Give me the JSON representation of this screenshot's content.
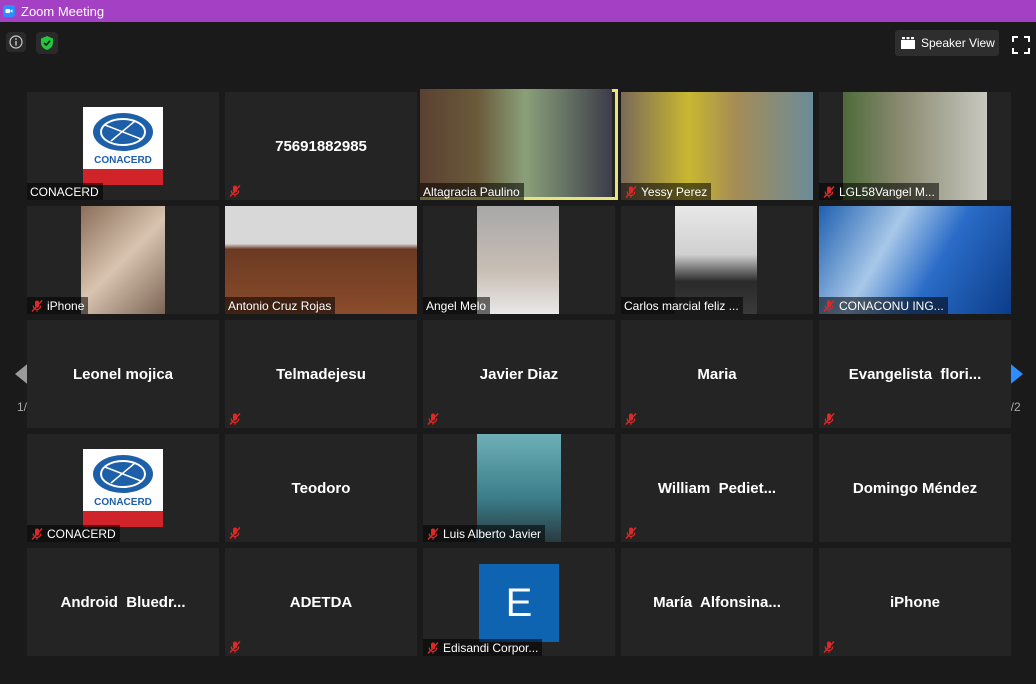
{
  "window": {
    "title": "Zoom Meeting"
  },
  "topbar": {
    "speaker_view_label": "Speaker View"
  },
  "pagination": {
    "left": "1/2",
    "right": "1/2"
  },
  "tiles": [
    {
      "name": "CONACERD",
      "logo": true,
      "logo_text": "CONACERD",
      "muted": false
    },
    {
      "name": "75691882985",
      "muted": true
    },
    {
      "name": "Altagracia Paulino",
      "video": true,
      "muted": false,
      "active": true
    },
    {
      "name": "Yessy Perez",
      "video": true,
      "muted": true
    },
    {
      "name": "LGL58Vangel M...",
      "video": true,
      "muted": true
    },
    {
      "name": "iPhone",
      "video": true,
      "muted": true
    },
    {
      "name": "Antonio Cruz Rojas",
      "video": true,
      "muted": false
    },
    {
      "name": "Angel Melo",
      "video": true,
      "muted": false
    },
    {
      "name": "Carlos marcial feliz ...",
      "video": true,
      "muted": false
    },
    {
      "name": "CONACONU ING...",
      "video": true,
      "muted": true
    },
    {
      "name": "Leonel mojica",
      "muted": false
    },
    {
      "name": "Telmadejesu",
      "muted": true
    },
    {
      "name": "Javier Diaz",
      "muted": true
    },
    {
      "name": "Maria",
      "muted": true
    },
    {
      "name": "Evangelista  flori...",
      "muted": true
    },
    {
      "name": "CONACERD",
      "logo": true,
      "logo_text": "CONACERD",
      "muted": true
    },
    {
      "name": "Teodoro",
      "muted": true
    },
    {
      "name": "Luis Alberto Javier",
      "video": true,
      "muted": true
    },
    {
      "name": "William  Pediet...",
      "muted": true
    },
    {
      "name": "Domingo Méndez",
      "muted": false
    },
    {
      "name": "Android  Bluedr...",
      "muted": false
    },
    {
      "name": "ADETDA",
      "muted": true
    },
    {
      "name": "Edisandi Corpor...",
      "avatar_letter": "E",
      "muted": true
    },
    {
      "name": "María  Alfonsina...",
      "muted": false
    },
    {
      "name": "iPhone",
      "muted": true
    }
  ],
  "colors": {
    "titlebar": "#a440c4",
    "active_border": "#e8e37a",
    "mic_muted": "#e02828",
    "accent": "#2d8cff"
  }
}
